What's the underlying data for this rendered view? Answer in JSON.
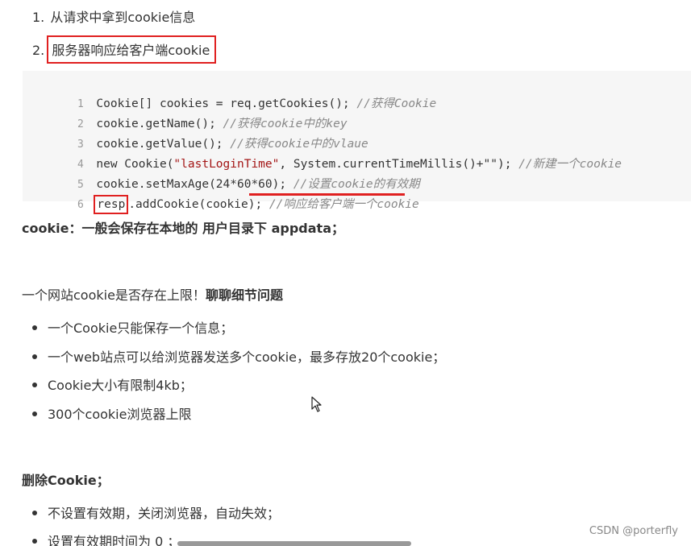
{
  "list": {
    "item1": {
      "num": "1.",
      "text": "从请求中拿到cookie信息"
    },
    "item2": {
      "num": "2.",
      "text": "服务器响应给客户端cookie"
    }
  },
  "code": {
    "lines": [
      {
        "num": "1",
        "code": "Cookie[] cookies = req.getCookies(); ",
        "comment": "//获得Cookie"
      },
      {
        "num": "2",
        "code": "cookie.getName(); ",
        "comment": "//获得cookie中的key"
      },
      {
        "num": "3",
        "code": "cookie.getValue(); ",
        "comment": "//获得cookie中的vlaue"
      },
      {
        "num": "4",
        "code_pre": "new Cookie(",
        "string": "\"lastLoginTime\"",
        "code_post": ", System.currentTimeMillis()+\"\"); ",
        "comment": "//新建一个cookie"
      },
      {
        "num": "5",
        "code": "cookie.setMaxAge(24*60*60); ",
        "comment": "//设置cookie的有效期"
      },
      {
        "num": "6",
        "resp": "resp",
        "code": ".addCookie(cookie); ",
        "comment": "//响应给客户端一个cookie"
      }
    ]
  },
  "note": {
    "label": "cookie：",
    "text": "一般会保存在本地的 用户目录下 appdata；"
  },
  "limit": {
    "text": "一个网站cookie是否存在上限！",
    "bold": "聊聊细节问题"
  },
  "limit_bullets": [
    "一个Cookie只能保存一个信息；",
    "一个web站点可以给浏览器发送多个cookie，最多存放20个cookie；",
    "Cookie大小有限制4kb；",
    "300个cookie浏览器上限"
  ],
  "delete": {
    "heading": "删除Cookie；"
  },
  "delete_bullets": [
    "不设置有效期，关闭浏览器，自动失效；",
    "设置有效期时间为 0 ；"
  ],
  "watermark": "CSDN @porterfly"
}
